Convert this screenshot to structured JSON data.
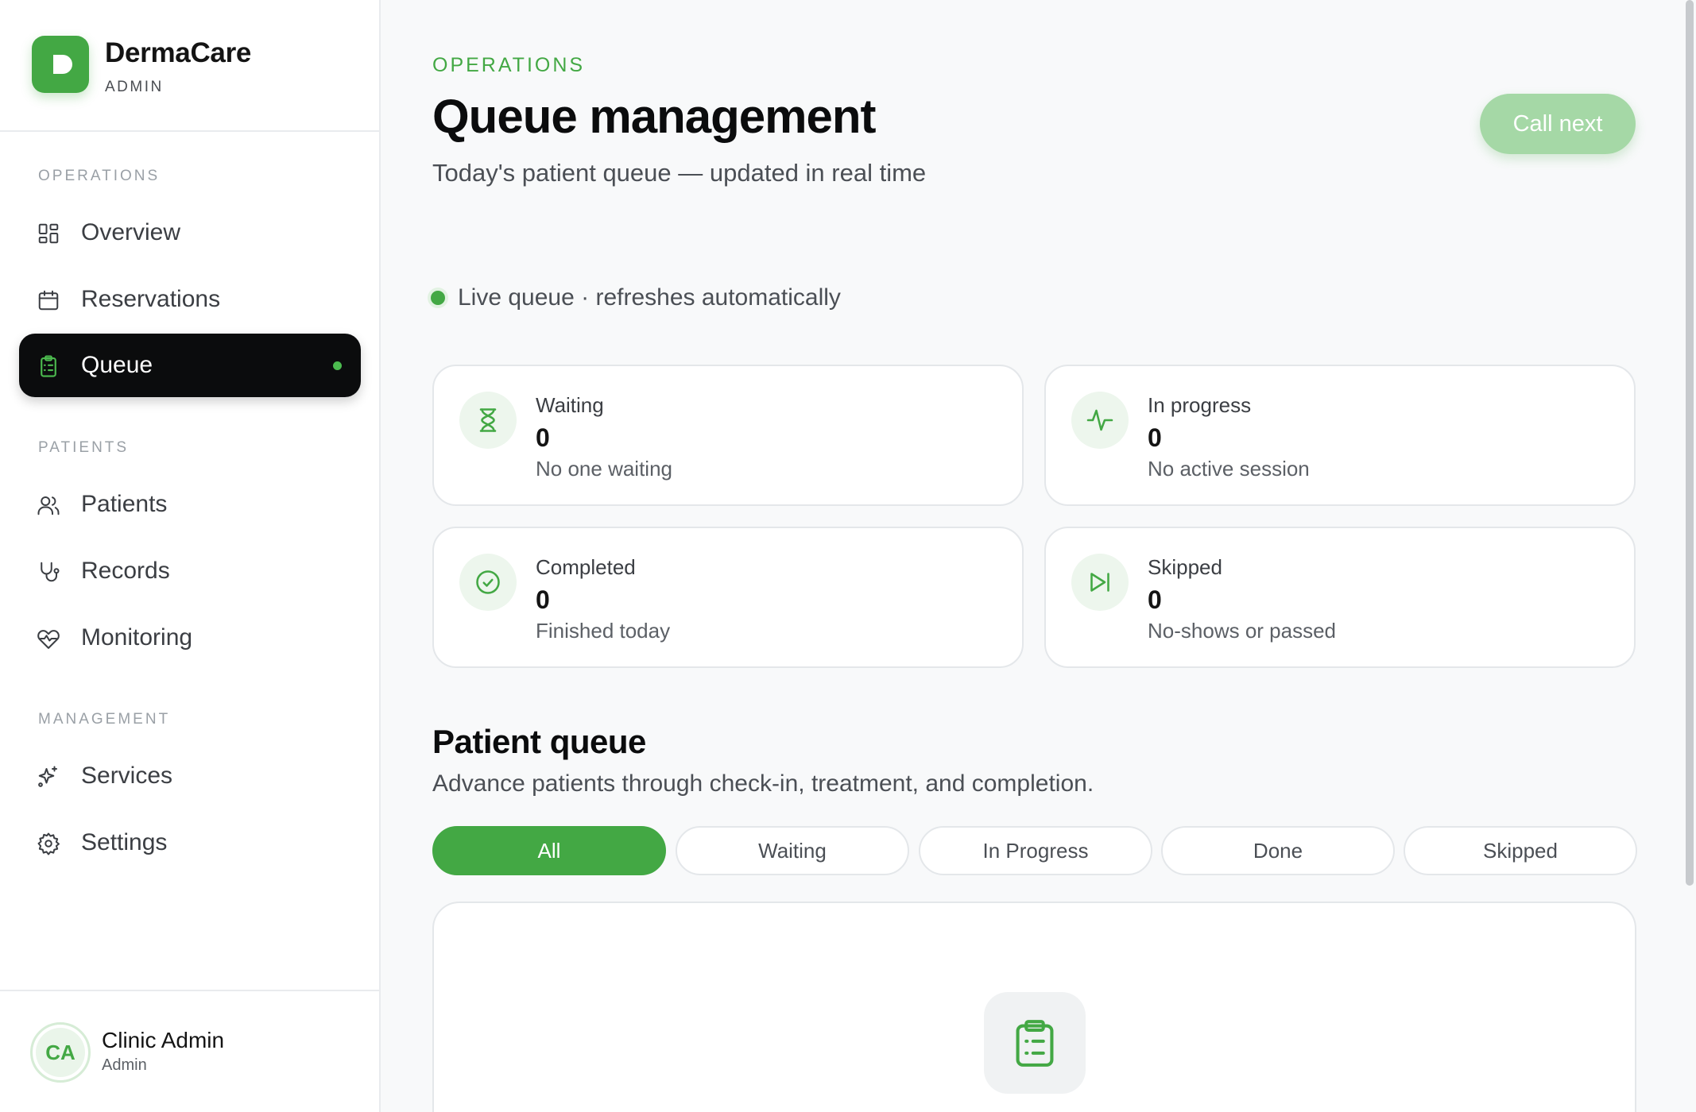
{
  "brand": {
    "initial": "D",
    "name": "DermaCare",
    "subtitle": "ADMIN"
  },
  "sidebar": {
    "sections": [
      {
        "title": "OPERATIONS",
        "items": [
          {
            "label": "Overview",
            "icon": "grid-icon"
          },
          {
            "label": "Reservations",
            "icon": "calendar-icon"
          },
          {
            "label": "Queue",
            "icon": "clipboard-icon",
            "active": true
          }
        ]
      },
      {
        "title": "PATIENTS",
        "items": [
          {
            "label": "Patients",
            "icon": "users-icon"
          },
          {
            "label": "Records",
            "icon": "stethoscope-icon"
          },
          {
            "label": "Monitoring",
            "icon": "heart-pulse-icon"
          }
        ]
      },
      {
        "title": "MANAGEMENT",
        "items": [
          {
            "label": "Services",
            "icon": "sparkles-icon"
          },
          {
            "label": "Settings",
            "icon": "gear-icon"
          }
        ]
      }
    ]
  },
  "profile": {
    "initials": "CA",
    "name": "Clinic Admin",
    "role": "Admin"
  },
  "header": {
    "eyebrow": "OPERATIONS",
    "title": "Queue management",
    "subtitle": "Today's patient queue — updated in real time",
    "call_next": "Call next"
  },
  "live_status": "Live queue · refreshes automatically",
  "stats": [
    {
      "label": "Waiting",
      "value": "0",
      "note": "No one waiting",
      "icon": "hourglass-icon"
    },
    {
      "label": "In progress",
      "value": "0",
      "note": "No active session",
      "icon": "activity-icon"
    },
    {
      "label": "Completed",
      "value": "0",
      "note": "Finished today",
      "icon": "check-circle-icon"
    },
    {
      "label": "Skipped",
      "value": "0",
      "note": "No-shows or passed",
      "icon": "skip-forward-icon"
    }
  ],
  "queue_section": {
    "title": "Patient queue",
    "subtitle": "Advance patients through check-in, treatment, and completion."
  },
  "filters": [
    {
      "label": "All",
      "active": true
    },
    {
      "label": "Waiting"
    },
    {
      "label": "In Progress"
    },
    {
      "label": "Done"
    },
    {
      "label": "Skipped"
    }
  ],
  "colors": {
    "accent": "#43a844",
    "accent_soft": "#a5d8a6",
    "active_nav": "#0b0c0d"
  }
}
